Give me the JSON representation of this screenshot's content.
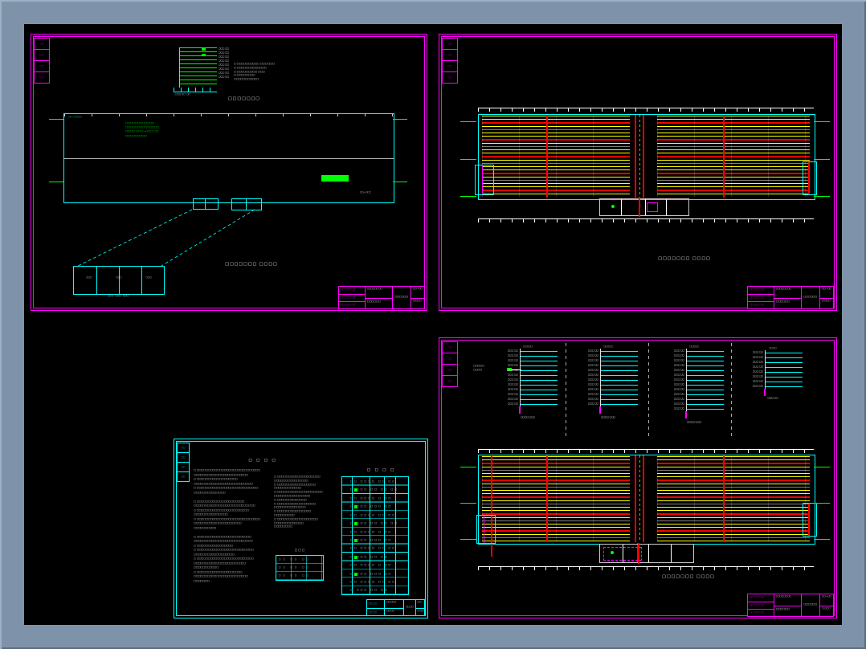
{
  "window": {
    "background": "#7E93AA",
    "canvas": "#000000"
  },
  "palette": {
    "magenta": "#FF00FF",
    "cyan": "#00FFFF",
    "green": "#00FF00",
    "red": "#FF0000",
    "yellow": "#FFFF00",
    "white": "#FFFFFF"
  },
  "sheet1": {
    "sig_cells": [
      "□□",
      "□□",
      "□□",
      "□□"
    ],
    "riser": {
      "branch_labels": [
        "□□□ □□",
        "□□□ □□",
        "□□□ □□",
        "□□□ □□",
        "□□□ □□",
        "□□□ □□",
        "□□□ □□",
        "□□□ □□"
      ],
      "notes": [
        "□·□□□□□□□□□□ □□□·□□□",
        "□·□□□□□□□□□□□□□",
        "□·□□□□□□□□□ □□□",
        "□·□□□□□□□□",
        "□□□□□□□□□□□"
      ],
      "base_label": "□□□·□□  □□",
      "title": "□□□□□□□"
    },
    "plan": {
      "corner_label": "□□—□□□□",
      "green_notes": [
        "□□□□□□□□□□□□",
        "□□□□□□□□□□□□□□",
        "□□□□ □□□—□□□ □□",
        "□□□□□□□□□"
      ],
      "right_label": "□□—□□□",
      "title": "□□□□□□□  □□□□"
    },
    "detail": {
      "cells": [
        "□□□",
        "□□□",
        "□□□"
      ],
      "dims": "□□□   □□□   □□□"
    },
    "titleblock": {
      "rev_rows": [
        "□□ □□□ □□",
        "□□ □□□ □□",
        "□□ □□□ □□"
      ],
      "org": "□□□□□□□□",
      "project": "□□□□□□",
      "drawing": "□□□□□□",
      "no": "□□—□□",
      "scale": "□:□□□"
    }
  },
  "sheet2": {
    "sig_cells": [
      "□□",
      "□□",
      "□□",
      "□□"
    ],
    "plan_title": "□□□□□□□  □□□□",
    "titleblock": {
      "rev_rows": [
        "□□ □□□ □□",
        "□□ □□□ □□",
        "□□ □□□ □□"
      ],
      "org": "□□□□□□□□",
      "project": "□□□□□□",
      "drawing": "□□□□□□",
      "no": "□□—□□",
      "scale": "□:□□□"
    }
  },
  "sheet3": {
    "sig_cells": [
      "□□",
      "□□",
      "□□",
      "□□"
    ],
    "heading_left": "□ □ □ □",
    "heading_right": "□ □ □ □",
    "left_lines": [
      "□ □□□□□□□□□□□□□□□□□□□□□□□□□□□□",
      "□□□□□□□□□□□□□□□□□□□□□□□□",
      "□ □□□□□□□□□□□□□□□□□□",
      "□□□□□□□□□□□□□□□□□□□□□□□□□□",
      "□ □□□□□□□□□□□□□□□□□□□□□□□□□□□",
      "□□□□□□□□□□□□□□",
      "",
      "□ □□□□□□□□□□□□□□□□□□□□□",
      "□□□□□□□□□□□□□□□□□□□□□□□□□□□",
      "□ □□□□□□□□□□□□□□□□□□□□□□□",
      "□□□□□□□□□□□□□□□",
      "□ □□□□□□□□□□□□□□□□□□□□□□□□□□□□",
      "□□□□□□□□□□□□□□□□□□□□□",
      "□□□□□□□□□□",
      "",
      "□ □□□□□□□□□□□□□□□□□□□□□□□□",
      "□□□□□□□□□□□□□□□□□□□□□□□□□□",
      "□ □□□□□□□□□□□□□□□□",
      "□ □□□□□□□□□□□□□□□□□□□□□□□□□",
      "□□□□□□□□□□□□□□□□□□",
      "□ □□□□□□□□□□□□□□□□□□□□□□□□□",
      "□□□□□□□□□□□□□□□□□□□□□□□",
      "□□□□□□□□□□□",
      "□ □□□□□□□□□□□□□□□□□□□□",
      "□□□□□□□□□□□□□□□□□□□□□□□□",
      "□□□□□□□"
    ],
    "mid_lines": [
      "□ □□□□□□□□□□□□□□□□□□□",
      "□□□□□□□□□□□□□□□",
      "□ □□□□□□□□□□□□□□□□□",
      "□□□□□□□□□□□□",
      "□ □□□□□□□□□□□□□□□□□□□□",
      "□□□□□□□□□□□□□□□□",
      "□ □□□□□□□□□□□□□",
      "□ □□□□□□□□□□□□□□□□□",
      "□□□□□□□□□□□□□□",
      "□ □□□□□□□□□□□□□□□",
      "□□□□□□□□□",
      "□ □□□□□□□□□□□□□□□□□□",
      "□□□□□□□□□□□□□",
      "□□□□□□□□"
    ],
    "mid_table_heading": "□ □ □",
    "mid_table_rows": [
      "□□ □□ □□",
      "□□ □□ □□",
      "□□ □□ □□"
    ],
    "table_rows": [
      "□□ □□□□ □□ □□",
      "□ □□□ □□ □□ □□",
      "□□ □□□□ □ □□",
      "□ □□□ □□□ □□",
      "□□ □□□□ □□ □□",
      "□ □□□ □□ □□ □□",
      "□□ □□□□ □ □□",
      "□ □□□ □□□ □□",
      "□□ □□□□ □□ □□",
      "□ □□□ □□ □□",
      "□□ □□□□ □ □□",
      "□ □□□ □□□ □□",
      "□□ □□□□ □□ □□",
      "□ □□□ □□ □□"
    ],
    "titleblock": {
      "rev_rows": [
        "□□ □□",
        "□□ □□"
      ],
      "org": "□□□□□",
      "project": "□□□□",
      "drawing": "□□□□",
      "no": "□□",
      "scale": "□:□□"
    }
  },
  "sheet4": {
    "sig_cells": [
      "□□",
      "□□",
      "□□",
      "□□"
    ],
    "feeder_lines": [
      "□□□□□",
      "□□□□"
    ],
    "groups": [
      {
        "header": "□□□□□",
        "labels": [
          "□□□ □□",
          "□□□ □□",
          "□□□ □□",
          "□□□ □□",
          "□□□ □□",
          "□□□ □□",
          "□□□ □□",
          "□□□ □□",
          "□□□ □□",
          "□□□ □□",
          "□□□ □□",
          "□□□ □□"
        ],
        "footer": "□□□□ □□□"
      },
      {
        "header": "□□□□□",
        "labels": [
          "□□□ □□",
          "□□□ □□",
          "□□□ □□",
          "□□□ □□",
          "□□□ □□",
          "□□□ □□",
          "□□□ □□",
          "□□□ □□",
          "□□□ □□",
          "□□□ □□",
          "□□□ □□",
          "□□□ □□"
        ],
        "footer": "□□□□ □□□"
      },
      {
        "header": "□□□□□",
        "labels": [
          "□□□ □□",
          "□□□ □□",
          "□□□ □□",
          "□□□ □□",
          "□□□ □□",
          "□□□ □□",
          "□□□ □□",
          "□□□ □□",
          "□□□ □□",
          "□□□ □□",
          "□□□ □□",
          "□□□ □□",
          "□□□ □□"
        ],
        "footer": "□□□□ □□□"
      },
      {
        "header": "□□□□",
        "labels": [
          "□□□ □□",
          "□□□ □□",
          "□□□ □□",
          "□□□ □□",
          "□□□ □□",
          "□□□ □□",
          "□□□ □□",
          "□□□ □□"
        ],
        "footer": "□□□ □□"
      }
    ],
    "plan_title": "□□□□□□□  □□□□",
    "titleblock": {
      "rev_rows": [
        "□□ □□□ □□",
        "□□ □□□ □□",
        "□□ □□□ □□"
      ],
      "org": "□□□□□□□□",
      "project": "□□□□□□",
      "drawing": "□□□□□□",
      "no": "□□—□□",
      "scale": "□:□□□"
    }
  }
}
